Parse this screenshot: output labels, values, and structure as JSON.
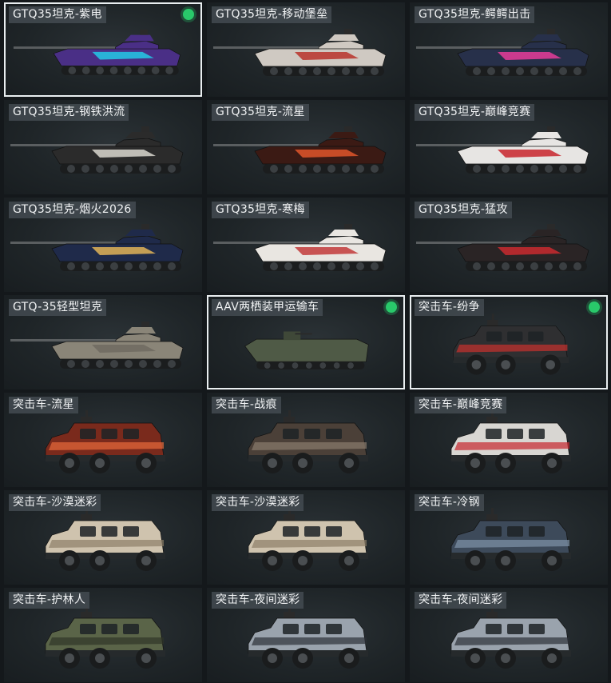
{
  "colors": {
    "owned_dot": "#29c86a",
    "selected_border": "#e9eef0",
    "card_bg": "#22292c"
  },
  "items": [
    {
      "name": "GTQ35坦克-紫电",
      "kind": "tank",
      "selected": true,
      "owned": true,
      "main": "#4a2f86",
      "accent": "#23c9e6"
    },
    {
      "name": "GTQ35坦克-移动堡垒",
      "kind": "tank",
      "selected": false,
      "owned": false,
      "main": "#cfc9c2",
      "accent": "#b8322a"
    },
    {
      "name": "GTQ35坦克-鳄鳄出击",
      "kind": "tank",
      "selected": false,
      "owned": false,
      "main": "#27304a",
      "accent": "#e83c9a"
    },
    {
      "name": "GTQ35坦克-钢铁洪流",
      "kind": "tank",
      "selected": false,
      "owned": false,
      "main": "#2b2b2b",
      "accent": "#d9d7cf"
    },
    {
      "name": "GTQ35坦克-流星",
      "kind": "tank",
      "selected": false,
      "owned": false,
      "main": "#3b1a14",
      "accent": "#e0562a"
    },
    {
      "name": "GTQ35坦克-巅峰竞赛",
      "kind": "tank",
      "selected": false,
      "owned": false,
      "main": "#e7e5e3",
      "accent": "#c8262d"
    },
    {
      "name": "GTQ35坦克-烟火2026",
      "kind": "tank",
      "selected": false,
      "owned": false,
      "main": "#1f2a4a",
      "accent": "#e2b357"
    },
    {
      "name": "GTQ35坦克-寒梅",
      "kind": "tank",
      "selected": false,
      "owned": false,
      "main": "#e9e6e1",
      "accent": "#c23a3a"
    },
    {
      "name": "GTQ35坦克-猛攻",
      "kind": "tank",
      "selected": false,
      "owned": false,
      "main": "#2a2425",
      "accent": "#c92a2f"
    },
    {
      "name": "GTQ-35轻型坦克",
      "kind": "tank",
      "selected": false,
      "owned": false,
      "main": "#8a8578",
      "accent": "#6e6a60"
    },
    {
      "name": "AAV两栖装甲运输车",
      "kind": "aav",
      "selected": true,
      "owned": true,
      "main": "#4f5a46",
      "accent": "#3f4838"
    },
    {
      "name": "突击车-纷争",
      "kind": "truck",
      "selected": true,
      "owned": true,
      "main": "#2f2f31",
      "accent": "#c7302e"
    },
    {
      "name": "突击车-流星",
      "kind": "truck",
      "selected": false,
      "owned": false,
      "main": "#7a2a1c",
      "accent": "#e86a3a"
    },
    {
      "name": "突击车-战痕",
      "kind": "truck",
      "selected": false,
      "owned": false,
      "main": "#4b4038",
      "accent": "#8a7c6d"
    },
    {
      "name": "突击车-巅峰竞赛",
      "kind": "truck",
      "selected": false,
      "owned": false,
      "main": "#d8d6d2",
      "accent": "#c8262d"
    },
    {
      "name": "突击车-沙漠迷彩",
      "kind": "truck",
      "selected": false,
      "owned": false,
      "main": "#cfc3ae",
      "accent": "#8d7f68"
    },
    {
      "name": "突击车-沙漠迷彩",
      "kind": "truck",
      "selected": false,
      "owned": false,
      "main": "#cfc3ae",
      "accent": "#8d7f68"
    },
    {
      "name": "突击车-冷钢",
      "kind": "truck",
      "selected": false,
      "owned": false,
      "main": "#3d4a5a",
      "accent": "#7f93a8"
    },
    {
      "name": "突击车-护林人",
      "kind": "truck",
      "selected": false,
      "owned": false,
      "main": "#5a6448",
      "accent": "#2f3528"
    },
    {
      "name": "突击车-夜间迷彩",
      "kind": "truck",
      "selected": false,
      "owned": false,
      "main": "#9aa3ad",
      "accent": "#2c3138"
    },
    {
      "name": "突击车-夜间迷彩",
      "kind": "truck",
      "selected": false,
      "owned": false,
      "main": "#9aa3ad",
      "accent": "#2c3138"
    }
  ]
}
